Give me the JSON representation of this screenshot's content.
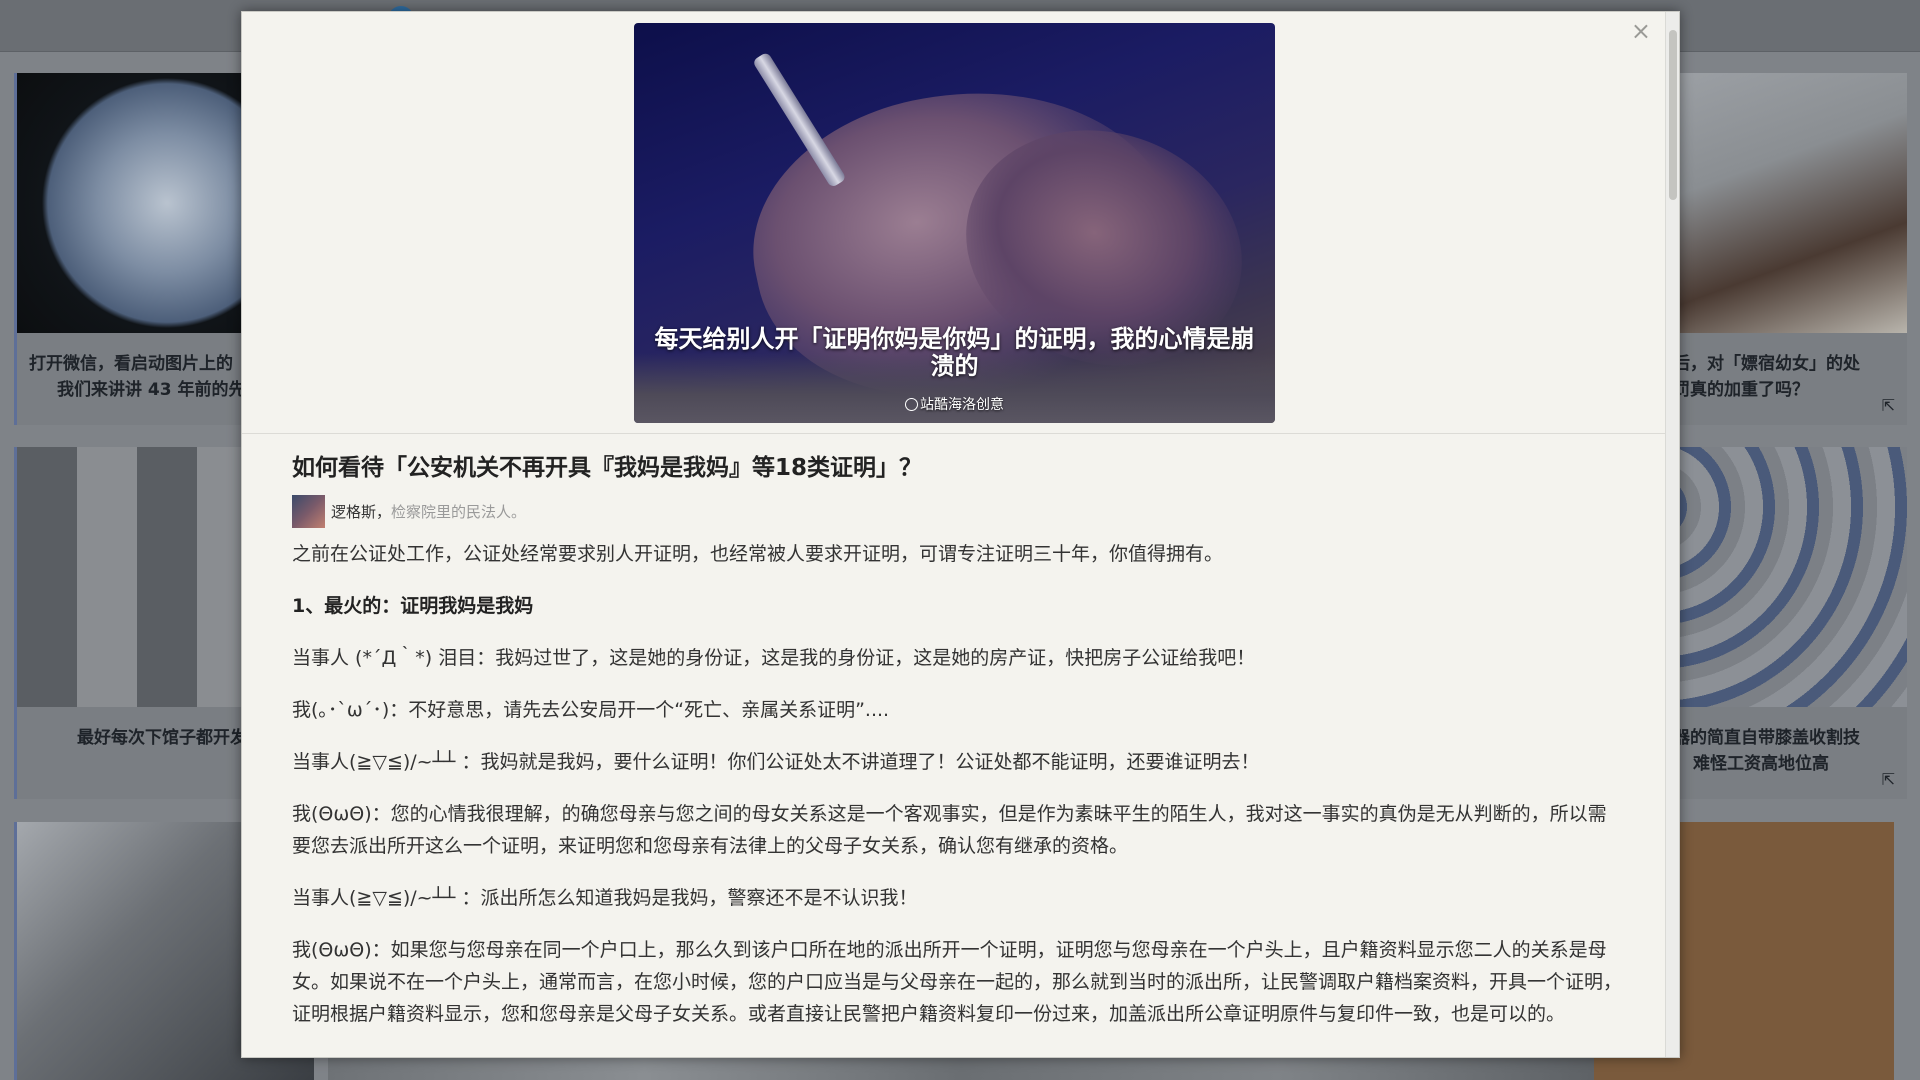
{
  "background_cards": [
    {
      "caption_lines": [
        "打开微信，看启动图片上的",
        "我们来讲讲 43 年前的先"
      ]
    },
    {
      "caption_lines": [
        "最好每次下馆子都开发"
      ]
    },
    {
      "caption_lines": []
    },
    {
      "caption_lines": [
        "后，对「嫖宿幼女」的处",
        "罚真的加重了吗？"
      ]
    },
    {
      "caption_lines": [
        "器的简直自带膝盖收割技",
        "难怪工资高地位高"
      ]
    },
    {
      "caption_lines": []
    }
  ],
  "modal": {
    "close_label": "×",
    "hero": {
      "title": "每天给别人开「证明你妈是你妈」的证明，我的心情是崩溃的",
      "credit": "站酷海洛创意"
    },
    "question_title": "如何看待「公安机关不再开具『我妈是我妈』等18类证明」？",
    "author": {
      "name": "逻格斯",
      "separator": "，",
      "bio": "检察院里的民法人。"
    },
    "paragraphs": [
      {
        "type": "text",
        "text": "之前在公证处工作，公证处经常要求别人开证明，也经常被人要求开证明，可谓专注证明三十年，你值得拥有。"
      },
      {
        "type": "section",
        "text": "1、最火的：证明我妈是我妈"
      },
      {
        "type": "text",
        "text": "当事人 (*´Д｀*) 泪目：我妈过世了，这是她的身份证，这是我的身份证，这是她的房产证，快把房子公证给我吧！"
      },
      {
        "type": "text",
        "text": "我(｡･`ω´･)：不好意思，请先去公安局开一个“死亡、亲属关系证明”...."
      },
      {
        "type": "text",
        "text": "当事人(≧▽≦)/~┴┴ ：我妈就是我妈，要什么证明！你们公证处太不讲道理了！公证处都不能证明，还要谁证明去！"
      },
      {
        "type": "text",
        "text": "我(ΘωΘ)：您的心情我很理解，的确您母亲与您之间的母女关系这是一个客观事实，但是作为素昧平生的陌生人，我对这一事实的真伪是无从判断的，所以需要您去派出所开这么一个证明，来证明您和您母亲有法律上的父母子女关系，确认您有继承的资格。"
      },
      {
        "type": "text",
        "text": "当事人(≧▽≦)/~┴┴ ：派出所怎么知道我妈是我妈，警察还不是不认识我！"
      },
      {
        "type": "text",
        "text": "我(ΘωΘ)：如果您与您母亲在同一个户口上，那么久到该户口所在地的派出所开一个证明，证明您与您母亲在一个户头上，且户籍资料显示您二人的关系是母女。如果说不在一个户头上，通常而言，在您小时候，您的户口应当是与父母亲在一起的，那么就到当时的派出所，让民警调取户籍档案资料，开具一个证明，证明根据户籍资料显示，您和您母亲是父母子女关系。或者直接让民警把户籍资料复印一份过来，加盖派出所公章证明原件与复印件一致，也是可以的。"
      }
    ]
  }
}
